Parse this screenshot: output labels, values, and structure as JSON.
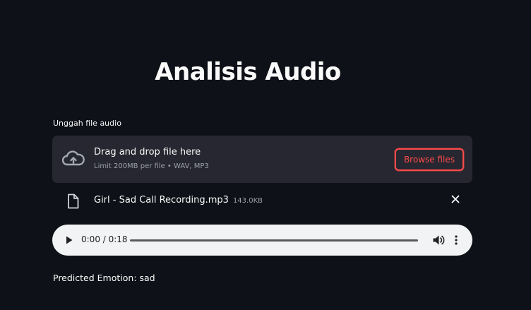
{
  "page": {
    "title": "Analisis Audio"
  },
  "uploader": {
    "label": "Unggah file audio",
    "drop_title": "Drag and drop file here",
    "drop_limit": "Limit 200MB per file • WAV, MP3",
    "browse_label": "Browse files",
    "icon": "cloud-upload-icon"
  },
  "uploaded_file": {
    "name": "Girl - Sad Call Recording.mp3",
    "size": "143.0KB",
    "icon": "file-icon"
  },
  "audio_player": {
    "time": "0:00 / 0:18",
    "progress": 0
  },
  "result": {
    "text": "Predicted Emotion: sad"
  },
  "colors": {
    "background": "#0e1117",
    "dropzone": "#262730",
    "accent": "#ff4b4b",
    "muted_text": "#9da0a9",
    "player_bg": "#f1f3f4"
  }
}
